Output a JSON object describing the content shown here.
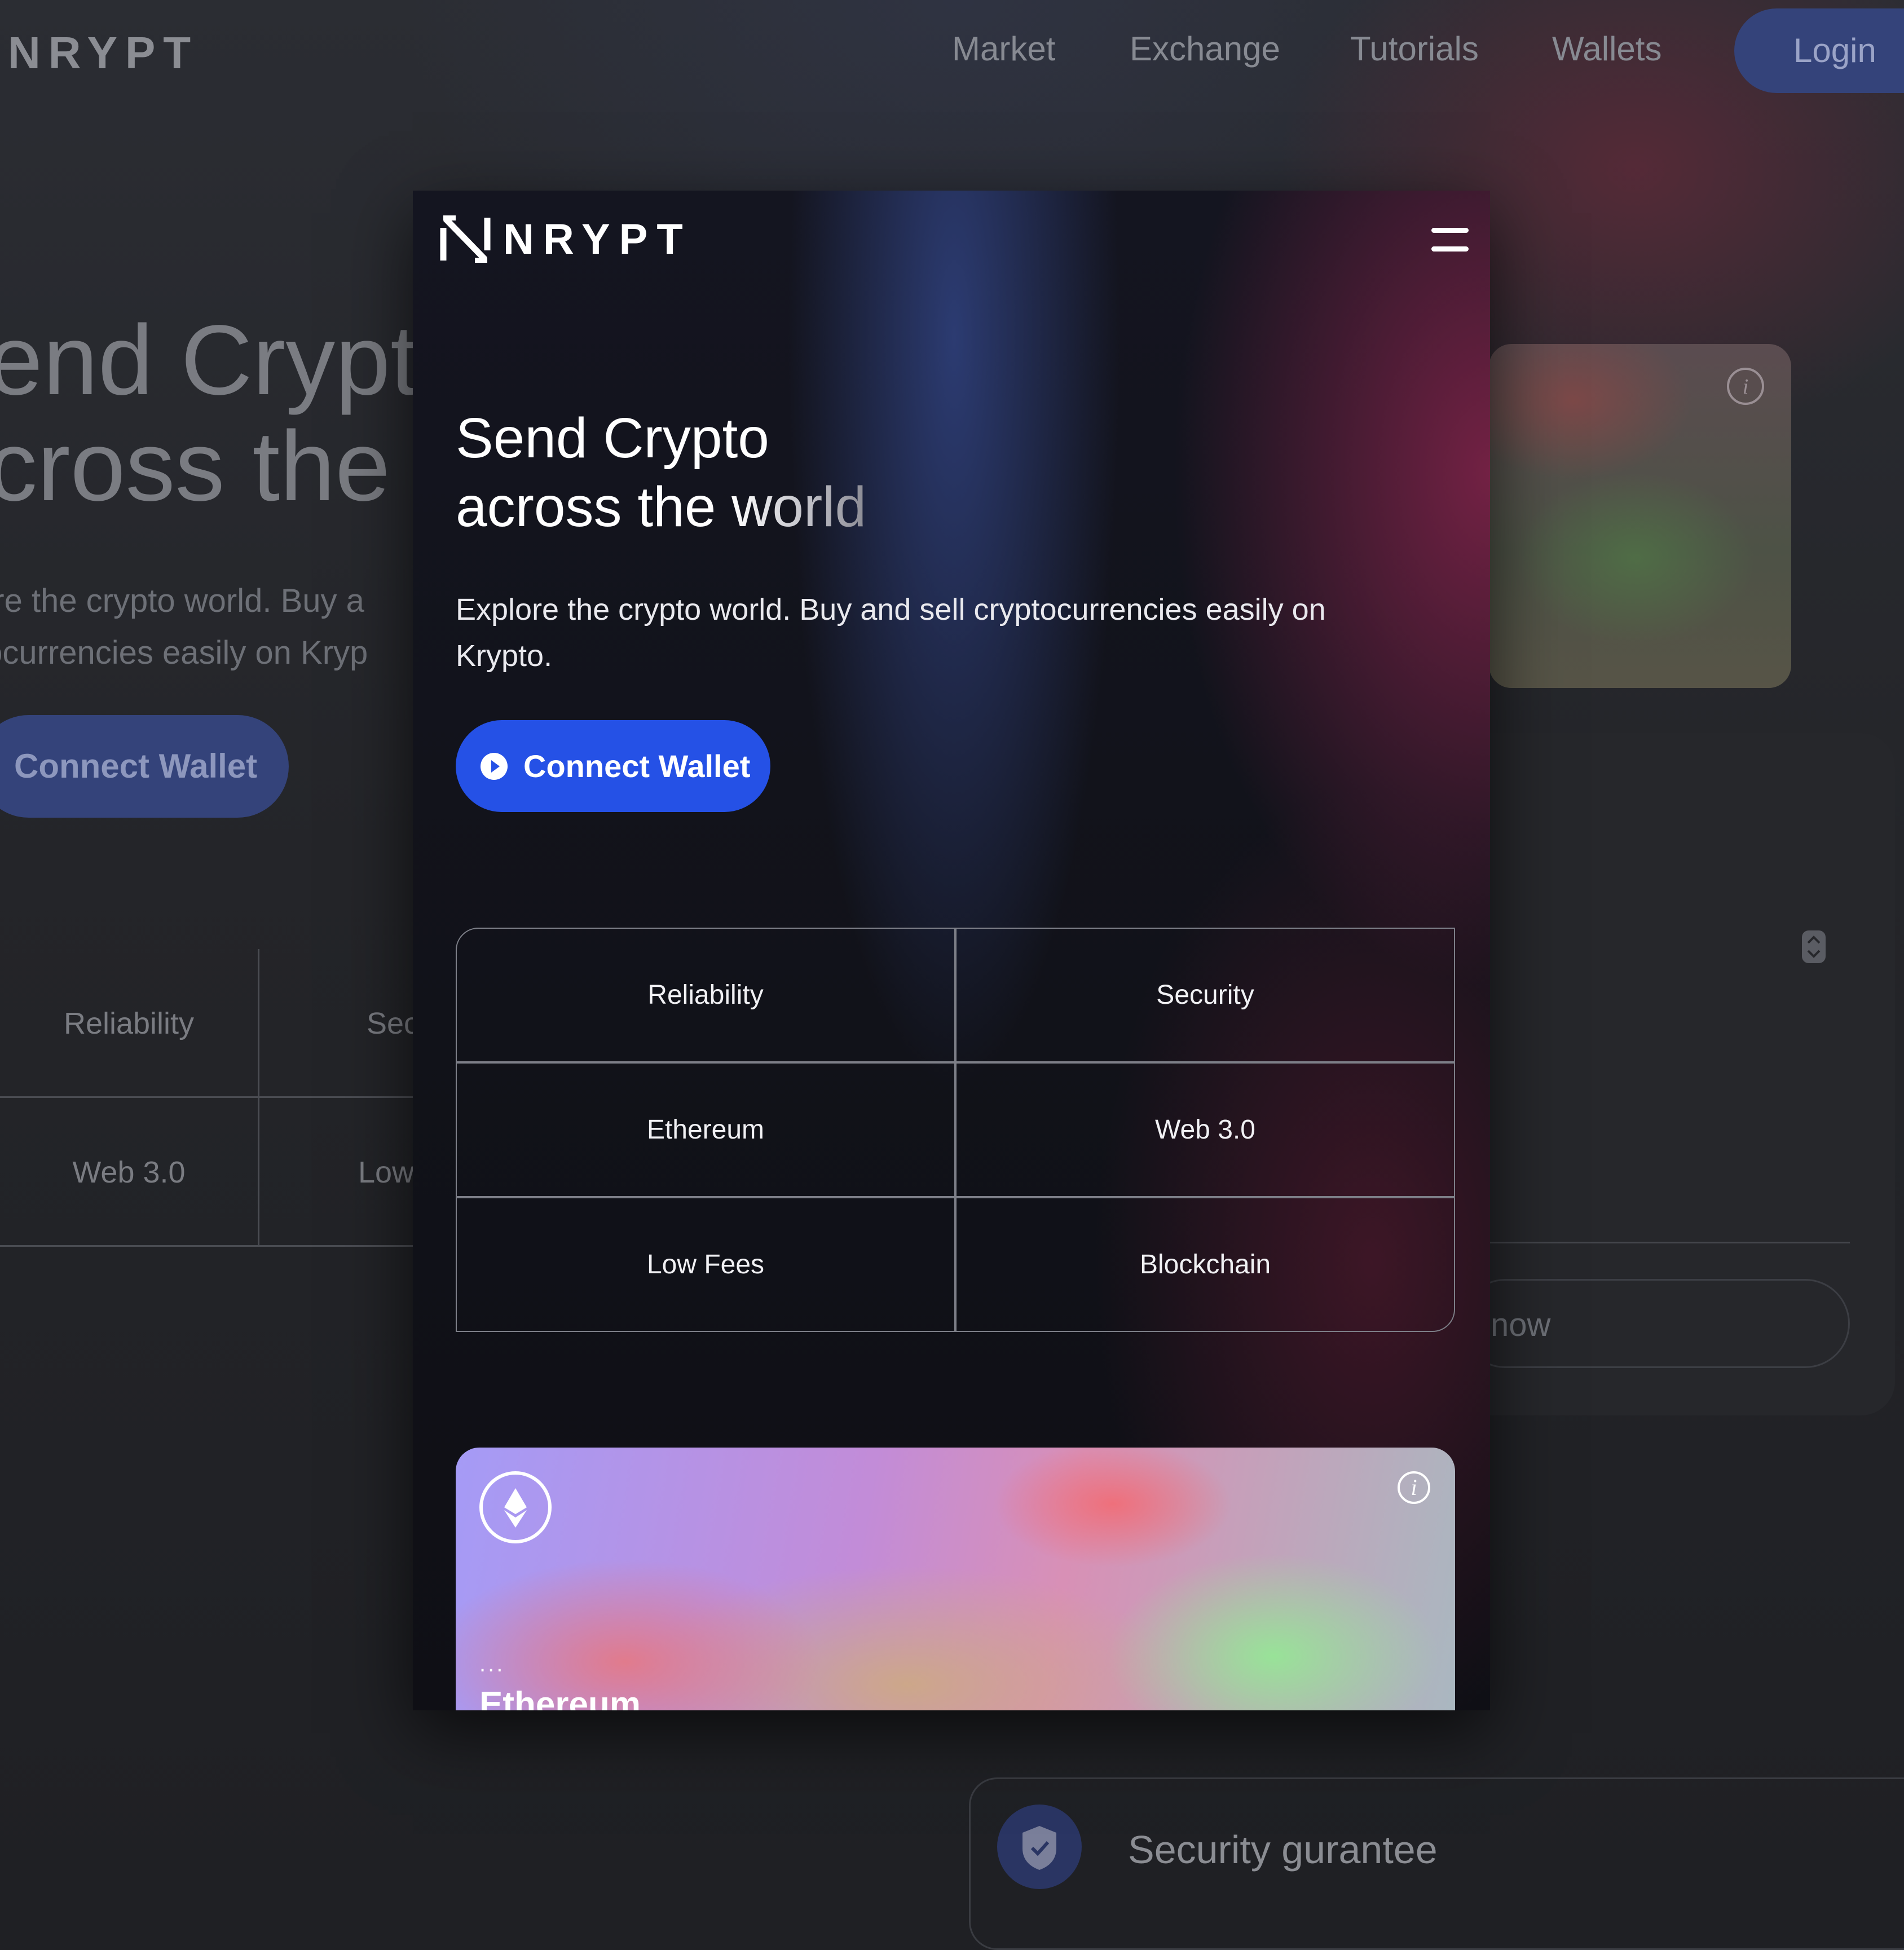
{
  "background": {
    "logo": "NRYPT",
    "nav": [
      "Market",
      "Exchange",
      "Tutorials",
      "Wallets"
    ],
    "login": "Login",
    "hero_line1": "end Crypt",
    "hero_line2": "cross the",
    "desc_line1": "ore the crypto world. Buy a",
    "desc_line2": "tocurrencies easily on Kryp",
    "connect": "Connect Wallet",
    "grid": [
      "Reliability",
      "Sec",
      "Web 3.0",
      "Low"
    ],
    "now_button": "now",
    "security_title": "Security gurantee"
  },
  "modal": {
    "logo": "NRYPT",
    "title_line1": "Send Crypto",
    "title_line2a": "across the ",
    "title_line2b": "world",
    "description": "Explore the crypto world. Buy and sell cryptocurrencies easily on Krypto.",
    "connect": "Connect Wallet",
    "features": [
      "Reliability",
      "Security",
      "Ethereum",
      "Web 3.0",
      "Low Fees",
      "Blockchain"
    ],
    "card": {
      "dots": "...",
      "name": "Ethereum",
      "info": "i"
    }
  },
  "colors": {
    "accent": "#2551e6",
    "background": "#1f2024"
  }
}
